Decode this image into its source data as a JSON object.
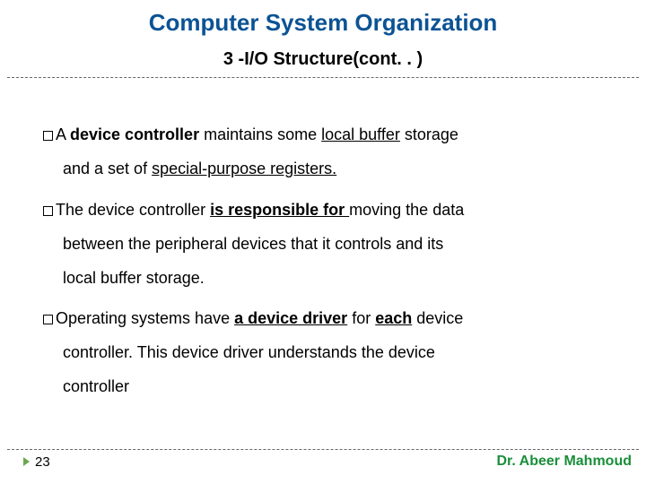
{
  "title": "Computer System Organization",
  "subtitle": "3 -I/O Structure(cont. . )",
  "bullets": {
    "b1": {
      "pre": "A ",
      "bold1": "device controller",
      "mid1": " maintains some ",
      "u1": "local buffer",
      "mid2": " storage",
      "cont1a": "and a set of ",
      "cont1u": "special-purpose registers.",
      "cont1b": ""
    },
    "b2": {
      "pre": "The device controller ",
      "bu1": "is responsible for ",
      "mid1": "moving the data",
      "cont1": "between the peripheral devices that it controls and its",
      "cont2": "local buffer storage."
    },
    "b3": {
      "pre": "Operating systems have ",
      "bu1": "a device driver",
      "mid1": " for ",
      "bu2": "each",
      "mid2": " device",
      "cont1": "controller. This device driver understands the device",
      "cont2": "controller"
    }
  },
  "footer": {
    "page": "23",
    "author": "Dr. Abeer Mahmoud"
  }
}
